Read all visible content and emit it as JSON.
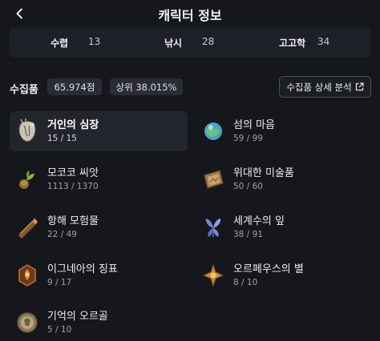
{
  "header": {
    "title": "캐릭터 정보"
  },
  "skills": [
    {
      "name": "수렵",
      "value": "13"
    },
    {
      "name": "낚시",
      "value": "28"
    },
    {
      "name": "고고학",
      "value": "34"
    }
  ],
  "summary": {
    "label": "수집품",
    "points": "65.974점",
    "rank": "상위 38.015%",
    "detail_button": "수집품 상세 분석"
  },
  "collections": [
    {
      "name": "거인의 심장",
      "count": "15 / 15",
      "icon": "giant-heart-icon",
      "selected": true
    },
    {
      "name": "섬의 마음",
      "count": "59 / 99",
      "icon": "island-heart-icon"
    },
    {
      "name": "모코코 씨앗",
      "count": "1113 / 1370",
      "icon": "mokoko-seed-icon"
    },
    {
      "name": "위대한 미술품",
      "count": "50 / 60",
      "icon": "great-artwork-icon"
    },
    {
      "name": "항해 모험물",
      "count": "22 / 49",
      "icon": "voyage-adventure-icon"
    },
    {
      "name": "세계수의 잎",
      "count": "38 / 91",
      "icon": "world-tree-leaf-icon"
    },
    {
      "name": "이그네아의 징표",
      "count": "9 / 17",
      "icon": "ignea-token-icon"
    },
    {
      "name": "오르페우스의 별",
      "count": "8 / 10",
      "icon": "orpheus-star-icon"
    },
    {
      "name": "기억의 오르골",
      "count": "5 / 10",
      "icon": "memory-orgel-icon"
    }
  ],
  "colors": {
    "background": "#15171c",
    "panel": "#1d2026",
    "pill": "#2a2d34",
    "muted_text": "#9ea2aa"
  }
}
